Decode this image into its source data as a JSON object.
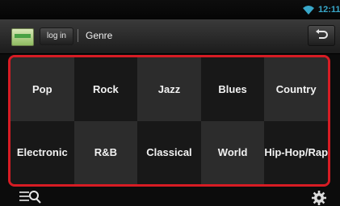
{
  "status": {
    "clock": "12:11",
    "wifi_icon": "wifi-icon"
  },
  "header": {
    "app_icon": "app-logo-icon",
    "login_label": "log in",
    "title": "Genre",
    "back_icon": "back-arrow-icon"
  },
  "genres": [
    {
      "label": "Pop"
    },
    {
      "label": "Rock"
    },
    {
      "label": "Jazz"
    },
    {
      "label": "Blues"
    },
    {
      "label": "Country"
    },
    {
      "label": "Electronic"
    },
    {
      "label": "R&B"
    },
    {
      "label": "Classical"
    },
    {
      "label": "World"
    },
    {
      "label": "Hip-Hop/Rap"
    }
  ],
  "footer": {
    "left_icon": "search-list-icon",
    "right_icon": "settings-icon"
  },
  "colors": {
    "highlight": "#d71c24",
    "clock": "#38a7c9"
  }
}
